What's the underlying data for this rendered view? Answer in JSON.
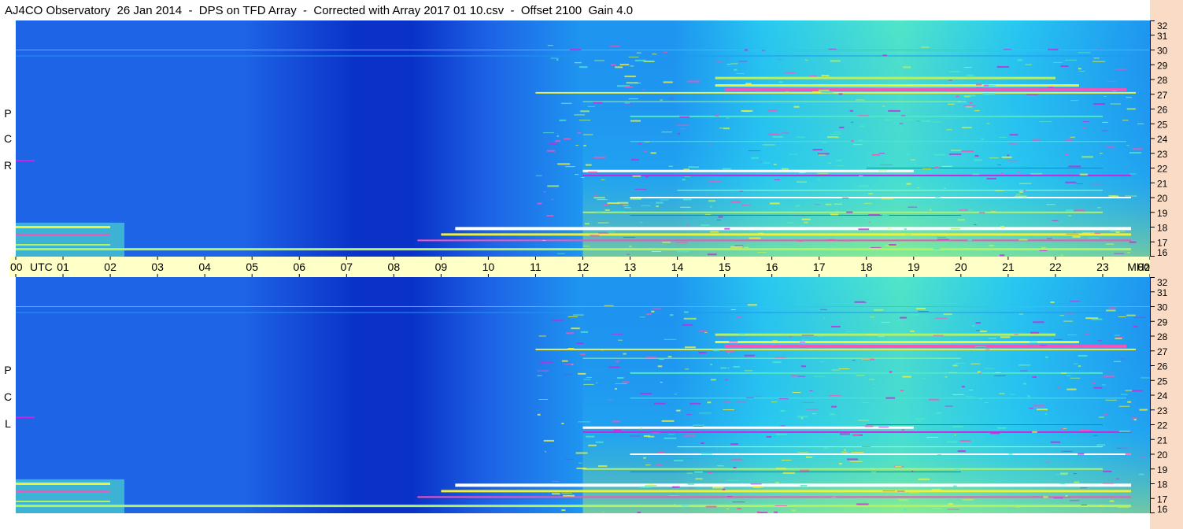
{
  "title": "AJ4CO Observatory  26 Jan 2014  -  DPS on TFD Array  -  Corrected with Array 2017 01 10.csv  -  Offset 2100  Gain 4.0",
  "chart_data": {
    "type": "heatmap",
    "title": "AJ4CO Observatory  26 Jan 2014  -  DPS on TFD Array  -  Corrected with Array 2017 01 10.csv  -  Offset 2100  Gain 4.0",
    "x_axis": {
      "tick_labels": [
        "00",
        "01",
        "02",
        "03",
        "04",
        "05",
        "06",
        "07",
        "08",
        "09",
        "10",
        "11",
        "12",
        "13",
        "14",
        "15",
        "16",
        "17",
        "18",
        "19",
        "20",
        "21",
        "22",
        "23",
        "00"
      ],
      "unit": "UTC",
      "range_hours": [
        0,
        24
      ]
    },
    "y_axis": {
      "unit": "MHz",
      "range_mhz": [
        16,
        32
      ],
      "tick_labels": [
        "16",
        "17",
        "18",
        "19",
        "20",
        "21",
        "22",
        "23",
        "24",
        "25",
        "26",
        "27",
        "28",
        "29",
        "30",
        "31",
        "32"
      ]
    },
    "colormap": [
      "#0a32c8",
      "#1e64e6",
      "#1e96f0",
      "#28c8f0",
      "#50e6c8",
      "#b4f064",
      "#f0f03c",
      "#ff50b4",
      "#c828dc",
      "#ffffff"
    ],
    "panels": [
      {
        "name": "R C P",
        "label_letters": [
          "P",
          "C",
          "R"
        ],
        "grid": false
      },
      {
        "name": "L C P",
        "label_letters": [
          "P",
          "C",
          "L"
        ],
        "grid": false
      }
    ]
  }
}
